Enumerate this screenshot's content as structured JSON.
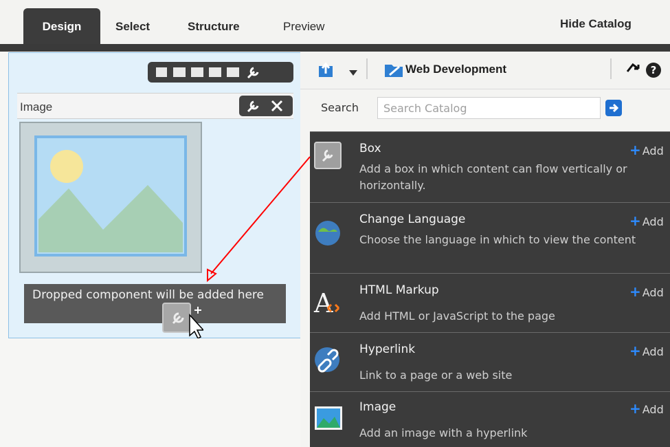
{
  "tabs": [
    {
      "label": "Design",
      "active": true
    },
    {
      "label": "Select",
      "active": false
    },
    {
      "label": "Structure",
      "active": false
    },
    {
      "label": "Preview",
      "active": false
    }
  ],
  "hide_catalog": "Hide Catalog",
  "image_component": {
    "label": "Image",
    "drop_tip": "Dropped component will be added here"
  },
  "catalog": {
    "title": "Web Development",
    "search": {
      "label": "Search",
      "placeholder": "Search Catalog"
    },
    "items": [
      {
        "title": "Box",
        "desc": "Add a box in which content can flow vertically or horizontally.",
        "add": "Add",
        "icon": "box-icon"
      },
      {
        "title": "Change Language",
        "desc": "Choose the language in which to view the content",
        "add": "Add",
        "icon": "globe-icon"
      },
      {
        "title": "HTML Markup",
        "desc": "Add HTML or JavaScript to the page",
        "add": "Add",
        "icon": "html-markup-icon"
      },
      {
        "title": "Hyperlink",
        "desc": "Link to a page or a web site",
        "add": "Add",
        "icon": "hyperlink-icon"
      },
      {
        "title": "Image",
        "desc": "Add an image with a hyperlink",
        "add": "Add",
        "icon": "image-icon"
      }
    ]
  },
  "colors": {
    "tab_active": "#3c3c3c",
    "catalog_bg": "#3b3b3b",
    "drop_area": "#e2f1fb",
    "accent_blue": "#2d8bff",
    "arrow_red": "#ff0000"
  }
}
